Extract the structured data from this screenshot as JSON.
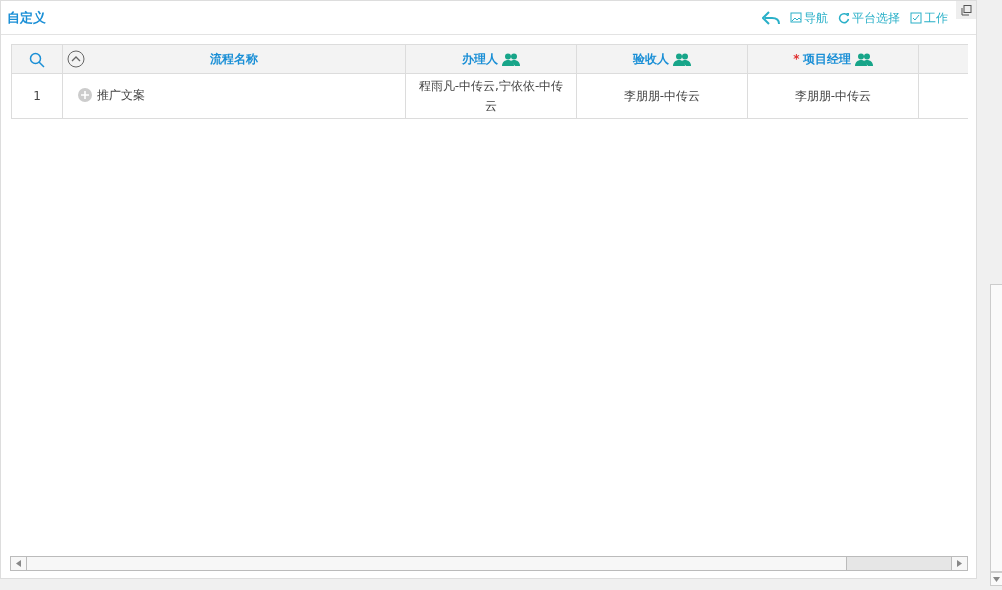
{
  "panel": {
    "title": "自定义"
  },
  "toolbar": [
    {
      "kind": "back"
    },
    {
      "kind": "nav",
      "label": "导航"
    },
    {
      "kind": "refresh",
      "label": "平台选择"
    },
    {
      "kind": "check",
      "label": "工作"
    }
  ],
  "table": {
    "columns": [
      {
        "kind": "search"
      },
      {
        "kind": "collapse",
        "label": "流程名称"
      },
      {
        "kind": "people",
        "label": "办理人"
      },
      {
        "kind": "people",
        "label": "验收人"
      },
      {
        "kind": "people",
        "label": "项目经理",
        "required_mark": "*"
      },
      {
        "kind": "blank"
      }
    ],
    "rows": [
      {
        "cells": [
          "1",
          "推广文案",
          "程雨凡-中传云,宁依依-中传云",
          "李朋朋-中传云",
          "李朋朋-中传云"
        ]
      }
    ]
  }
}
